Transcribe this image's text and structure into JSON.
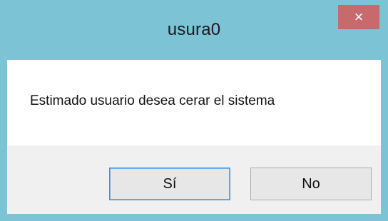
{
  "window": {
    "title": "usura0",
    "close_glyph": "×"
  },
  "dialog": {
    "message": "Estimado usuario desea cerar el sistema"
  },
  "buttons": {
    "yes_label": "Sí",
    "no_label": "No"
  },
  "colors": {
    "frame": "#7cc3d6",
    "close_button": "#c8696b",
    "content_background": "#ffffff",
    "footer_background": "#f0f0f0",
    "default_button_border": "#3c8fd8"
  }
}
